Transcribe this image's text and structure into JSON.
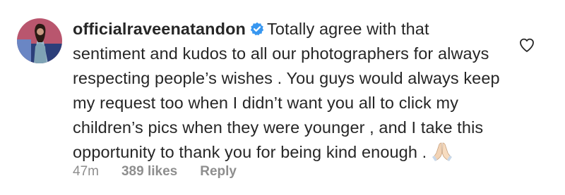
{
  "comment": {
    "username": "officialraveenatandon",
    "text": "Totally agree with that sentiment and kudos to all our photographers for always respecting people’s wishes . You guys would always keep my request too when I didn’t want you all to click my children’s pics when they were younger , and I take this opportunity to thank you for being kind enough .",
    "emoji": "folded-hands-emoji",
    "time": "47m",
    "likes": "389 likes",
    "reply_label": "Reply"
  },
  "icons": {
    "verified": "verified-badge-icon",
    "like": "heart-outline-icon"
  },
  "colors": {
    "text": "#262626",
    "secondary": "#8e8e8e",
    "verified_blue": "#3897f0"
  }
}
